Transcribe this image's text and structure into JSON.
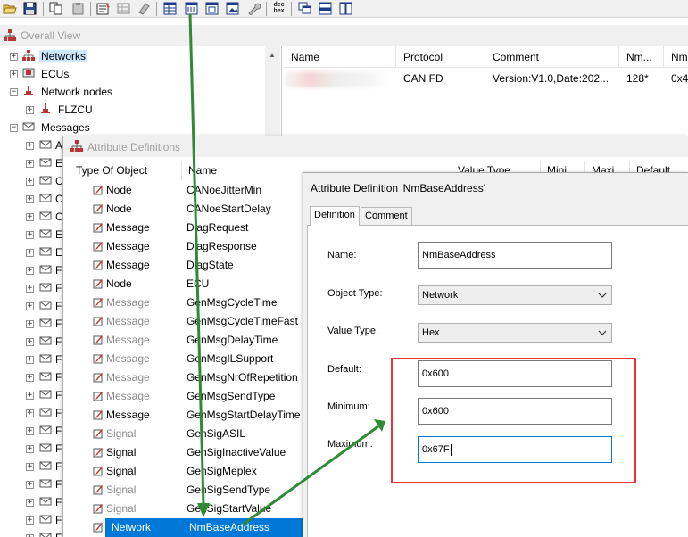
{
  "toolbar": {
    "buttons": [
      "open-folder-icon",
      "save-icon",
      "copy-icon",
      "paste-icon",
      "properties-icon",
      "grid-icon",
      "eraser-icon",
      "table-icon",
      "table-edit-icon",
      "window-icon",
      "image-icon",
      "wrench-icon",
      "hex-icon",
      "cascade-icon",
      "tile-horizontal-icon",
      "tile-vertical-icon"
    ],
    "hex_label_top": "dec",
    "hex_label_bottom": "hex"
  },
  "overall_view": {
    "title": "Overall View",
    "tree": [
      {
        "label": "Networks",
        "icon": "network-icon"
      },
      {
        "label": "ECUs",
        "icon": "ecu-icon"
      },
      {
        "label": "Network nodes",
        "icon": "node-icon"
      },
      {
        "label": "FLZCU",
        "icon": "node-icon"
      },
      {
        "label": "Messages",
        "icon": "message-icon"
      }
    ],
    "collapsed_child_letters": [
      "A",
      "E",
      "C",
      "C",
      "C",
      "E",
      "E",
      "F",
      "F",
      "F",
      "F",
      "F",
      "F",
      "F",
      "F",
      "F",
      "F",
      "F",
      "F",
      "F",
      "F",
      "F",
      "F"
    ],
    "grid": {
      "columns": [
        "Name",
        "Protocol",
        "Comment",
        "Nm...",
        "Nm"
      ],
      "row": [
        "",
        "CAN FD",
        "Version:V1.0,Date:202...",
        "128*",
        "0x4"
      ]
    }
  },
  "attribute_definitions": {
    "title": "Attribute Definitions",
    "columns": [
      "Type Of Object",
      "Name",
      "Value Type",
      "Mini...",
      "Maxi...",
      "Default"
    ],
    "rows": [
      {
        "type": "Node",
        "name": "CANoeJitterMin",
        "dim": false
      },
      {
        "type": "Node",
        "name": "CANoeStartDelay",
        "dim": false
      },
      {
        "type": "Message",
        "name": "DiagRequest",
        "dim": false
      },
      {
        "type": "Message",
        "name": "DiagResponse",
        "dim": false
      },
      {
        "type": "Message",
        "name": "DiagState",
        "dim": false
      },
      {
        "type": "Node",
        "name": "ECU",
        "dim": false
      },
      {
        "type": "Message",
        "name": "GenMsgCycleTime",
        "dim": true
      },
      {
        "type": "Message",
        "name": "GenMsgCycleTimeFast",
        "dim": true
      },
      {
        "type": "Message",
        "name": "GenMsgDelayTime",
        "dim": true
      },
      {
        "type": "Message",
        "name": "GenMsgILSupport",
        "dim": true
      },
      {
        "type": "Message",
        "name": "GenMsgNrOfRepetition",
        "dim": true
      },
      {
        "type": "Message",
        "name": "GenMsgSendType",
        "dim": true
      },
      {
        "type": "Message",
        "name": "GenMsgStartDelayTime",
        "dim": false
      },
      {
        "type": "Signal",
        "name": "GenSigASIL",
        "dim": true
      },
      {
        "type": "Signal",
        "name": "GenSigInactiveValue",
        "dim": false
      },
      {
        "type": "Signal",
        "name": "GenSigMeplex",
        "dim": false
      },
      {
        "type": "Signal",
        "name": "GenSigSendType",
        "dim": true
      },
      {
        "type": "Signal",
        "name": "GenSigStartValue",
        "dim": true
      },
      {
        "type": "Network",
        "name": "NmBaseAddress",
        "selected": true
      }
    ]
  },
  "dialog": {
    "title": "Attribute Definition 'NmBaseAddress'",
    "tabs": [
      "Definition",
      "Comment"
    ],
    "fields": {
      "name_label": "Name:",
      "name_value": "NmBaseAddress",
      "object_type_label": "Object Type:",
      "object_type_value": "Network",
      "value_type_label": "Value Type:",
      "value_type_value": "Hex",
      "default_label": "Default:",
      "default_value": "0x600",
      "minimum_label": "Minimum:",
      "minimum_value": "0x600",
      "maximum_label": "Maximum:",
      "maximum_value": "0x67F"
    }
  },
  "colors": {
    "highlight_box": "#e8353a",
    "annotation_arrow": "#2f8a36",
    "selection": "#0078d7"
  }
}
